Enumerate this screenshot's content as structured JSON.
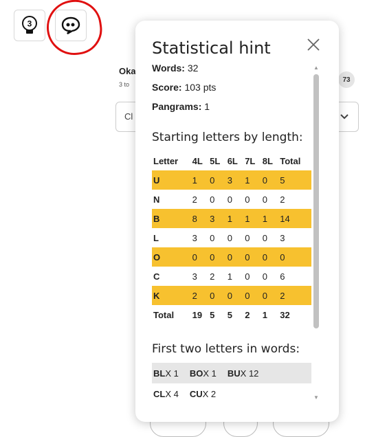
{
  "toolbar": {
    "hint_count": "3"
  },
  "background": {
    "title_partial": "Oka",
    "subtitle_partial": "3 to",
    "badge": "73",
    "select_partial": "Cl"
  },
  "modal": {
    "title": "Statistical hint",
    "words_label": "Words:",
    "words_value": "32",
    "score_label": "Score:",
    "score_value": "103 pts",
    "pangrams_label": "Pangrams:",
    "pangrams_value": "1",
    "starting_title": "Starting letters by length:",
    "table": {
      "headers": [
        "Letter",
        "4L",
        "5L",
        "6L",
        "7L",
        "8L",
        "Total"
      ],
      "rows": [
        [
          "U",
          "1",
          "0",
          "3",
          "1",
          "0",
          "5"
        ],
        [
          "N",
          "2",
          "0",
          "0",
          "0",
          "0",
          "2"
        ],
        [
          "B",
          "8",
          "3",
          "1",
          "1",
          "1",
          "14"
        ],
        [
          "L",
          "3",
          "0",
          "0",
          "0",
          "0",
          "3"
        ],
        [
          "O",
          "0",
          "0",
          "0",
          "0",
          "0",
          "0"
        ],
        [
          "C",
          "3",
          "2",
          "1",
          "0",
          "0",
          "6"
        ],
        [
          "K",
          "2",
          "0",
          "0",
          "0",
          "0",
          "2"
        ]
      ],
      "total": [
        "Total",
        "19",
        "5",
        "5",
        "2",
        "1",
        "32"
      ]
    },
    "two_letters_title": "First two letters in words:",
    "two_letters": [
      [
        {
          "p": "BL",
          "c": "X 1"
        },
        {
          "p": "BO",
          "c": "X 1"
        },
        {
          "p": "BU",
          "c": "X 12"
        }
      ],
      [
        {
          "p": "CL",
          "c": "X 4"
        },
        {
          "p": "CU",
          "c": "X 2"
        }
      ]
    ]
  },
  "colors": {
    "highlight": "#f7c12f",
    "annotation": "#e01010"
  }
}
